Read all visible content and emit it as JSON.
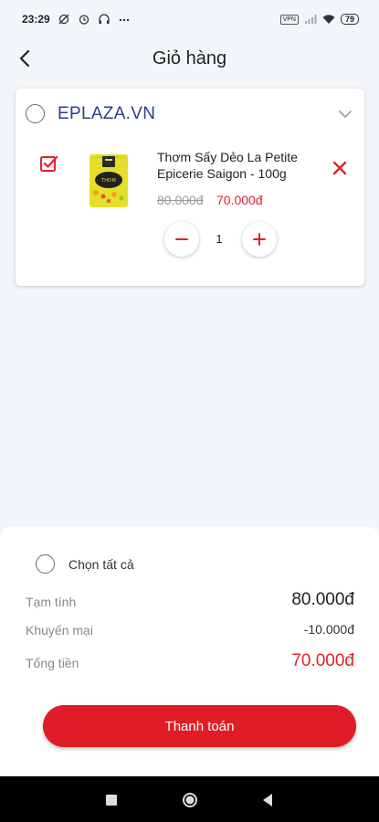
{
  "status_bar": {
    "time": "23:29",
    "battery": "79",
    "vpn": "VPN",
    "left_icons": [
      "no-data-sync-icon",
      "alarm-icon",
      "headset-icon",
      "more-dots-icon"
    ],
    "right_icons": [
      "vpn-icon",
      "signal-icon",
      "wifi-icon",
      "battery-icon"
    ]
  },
  "header": {
    "title": "Giỏ hàng",
    "back_icon": "chevron-left-icon"
  },
  "cart": {
    "shop_name": "EPLAZA.VN",
    "items": [
      {
        "name": "Thơm Sấy Dẻo La Petite Epicerie Saigon - 100g",
        "old_price": "80.000đ",
        "price": "70.000đ",
        "quantity": "1",
        "checked": true
      }
    ]
  },
  "summary": {
    "select_all_label": "Chọn tất cả",
    "subtotal_label": "Tạm tính",
    "subtotal_value": "80.000đ",
    "promo_label": "Khuyến mại",
    "promo_value": "-10.000đ",
    "total_label": "Tổng tiền",
    "total_value": "70.000đ",
    "checkout_label": "Thanh toán"
  },
  "colors": {
    "accent_red": "#e01d26",
    "shop_blue": "#2e3c8c",
    "background": "#f3f6f9"
  }
}
